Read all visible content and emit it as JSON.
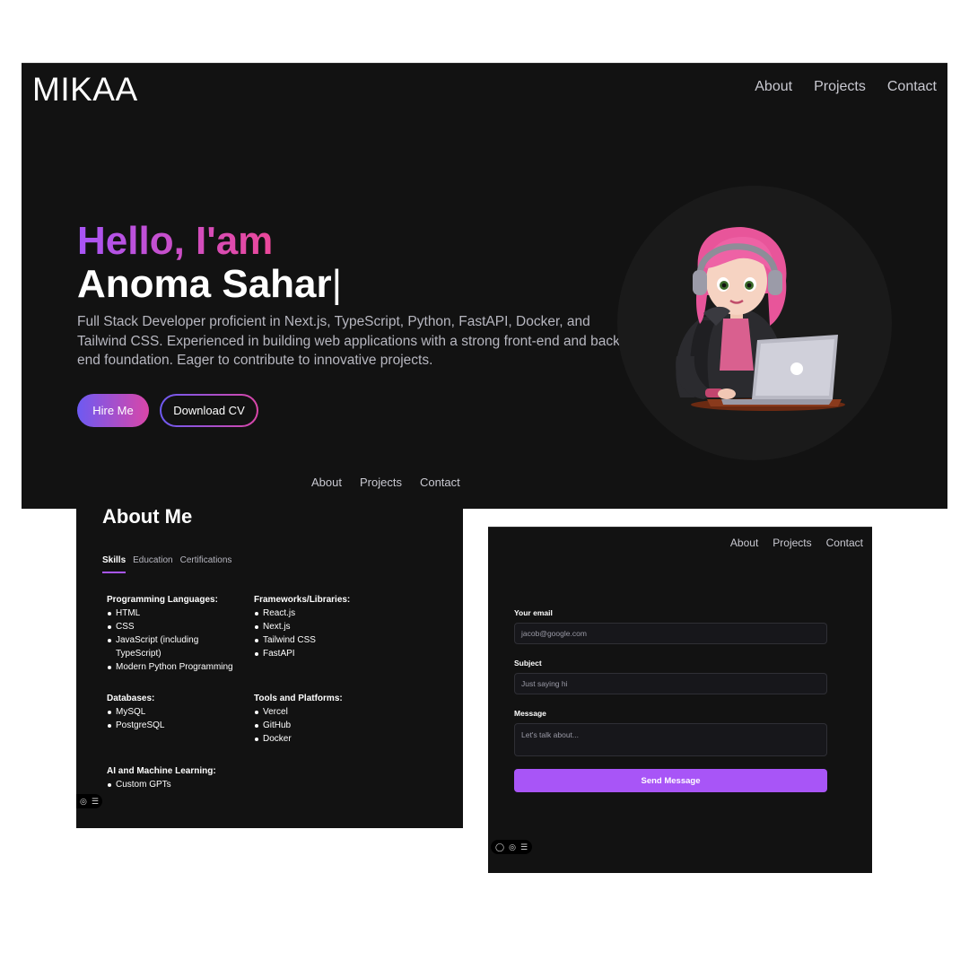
{
  "hero": {
    "logo": "MIKAA",
    "nav": [
      "About",
      "Projects",
      "Contact"
    ],
    "greeting": "Hello, I'am",
    "name": "Anoma Sahar",
    "cursor": "|",
    "description": "Full Stack Developer proficient in Next.js, TypeScript, Python, FastAPI, Docker, and Tailwind CSS. Experienced in building web applications with a strong front-end and back-end foundation. Eager to contribute to innovative projects.",
    "hire_label": "Hire Me",
    "cv_label": "Download CV",
    "avatar_icon": "developer-avatar-illustration",
    "subnav": [
      "About",
      "Projects",
      "Contact"
    ]
  },
  "about": {
    "title": "About Me",
    "tabs": [
      "Skills",
      "Education",
      "Certifications"
    ],
    "active_tab": "Skills",
    "groups": [
      {
        "title": "Programming Languages:",
        "items": [
          "HTML",
          "CSS",
          "JavaScript (including TypeScript)",
          "Modern Python Programming"
        ]
      },
      {
        "title": "Frameworks/Libraries:",
        "items": [
          "React.js",
          "Next.js",
          "Tailwind CSS",
          "FastAPI"
        ]
      },
      {
        "title": "Databases:",
        "items": [
          "MySQL",
          "PostgreSQL"
        ]
      },
      {
        "title": "Tools and Platforms:",
        "items": [
          "Vercel",
          "GitHub",
          "Docker"
        ]
      },
      {
        "title": "AI and Machine Learning:",
        "items": [
          "Custom GPTs"
        ]
      }
    ],
    "toolbar_icons": [
      "eye-icon",
      "sliders-icon"
    ]
  },
  "contact": {
    "nav": [
      "About",
      "Projects",
      "Contact"
    ],
    "email_label": "Your email",
    "email_placeholder": "jacob@google.com",
    "subject_label": "Subject",
    "subject_placeholder": "Just saying hi",
    "message_label": "Message",
    "message_placeholder": "Let's talk about...",
    "send_label": "Send Message",
    "toolbar_icons": [
      "chat-icon",
      "eye-icon",
      "sliders-icon"
    ]
  },
  "colors": {
    "background": "#121212",
    "accent_purple": "#a855f7",
    "accent_pink": "#ec4899",
    "text_muted": "#b7b7c0"
  }
}
